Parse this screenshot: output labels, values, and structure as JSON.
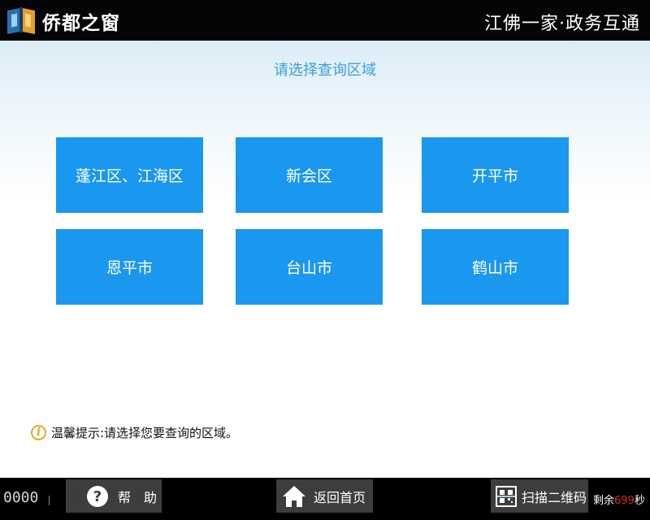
{
  "header": {
    "app_title": "侨都之窗",
    "slogan": "江佛一家·政务互通",
    "logo_icon": "book-logo-icon"
  },
  "main": {
    "prompt": "请选择查询区域",
    "regions": [
      {
        "label": "蓬江区、江海区"
      },
      {
        "label": "新会区"
      },
      {
        "label": "开平市"
      },
      {
        "label": "恩平市"
      },
      {
        "label": "台山市"
      },
      {
        "label": "鹤山市"
      }
    ],
    "tip": {
      "icon": "info-icon",
      "text": "温馨提示:请选择您要查询的区域。"
    }
  },
  "footer": {
    "counter": "0000",
    "help_label": "帮　助",
    "home_label": "返回首页",
    "scan_label": "扫描二维码",
    "remaining_prefix": "剩余",
    "remaining_seconds": "699",
    "remaining_suffix": "秒"
  },
  "colors": {
    "accent": "#1a98ef",
    "prompt_text": "#3d9fd6",
    "header_bg": "#050505",
    "countdown": "#e02828"
  }
}
